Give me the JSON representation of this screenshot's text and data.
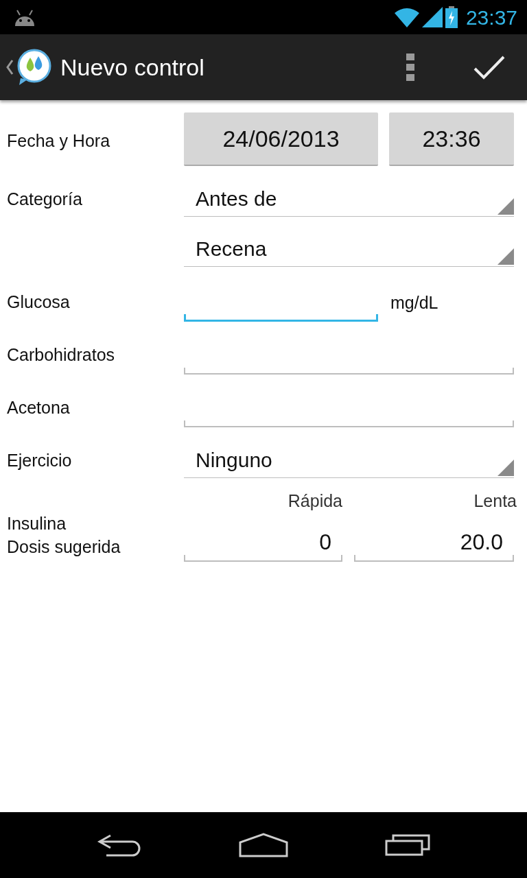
{
  "status_bar": {
    "time": "23:37"
  },
  "action_bar": {
    "title": "Nuevo control"
  },
  "fields": [
    {
      "kind": "datetime",
      "label": "Fecha y Hora",
      "date": "24/06/2013",
      "time": "23:36"
    },
    {
      "kind": "spinners",
      "label": "Categoría",
      "options": [
        "Antes de",
        "Recena"
      ]
    },
    {
      "kind": "input",
      "label": "Glucosa",
      "unit": "mg/dL",
      "focused": true
    },
    {
      "kind": "input",
      "label": "Carbohidratos",
      "focused": false
    },
    {
      "kind": "input",
      "label": "Acetona",
      "focused": false
    },
    {
      "kind": "spinners",
      "label": "Ejercicio",
      "options": [
        "Ninguno"
      ]
    },
    {
      "kind": "insulin",
      "labels": [
        "Insulina",
        "Dosis sugerida"
      ],
      "columns": [
        {
          "heading": "Rápida",
          "value": "0"
        },
        {
          "heading": "Lenta",
          "value": "20.0"
        }
      ]
    }
  ]
}
